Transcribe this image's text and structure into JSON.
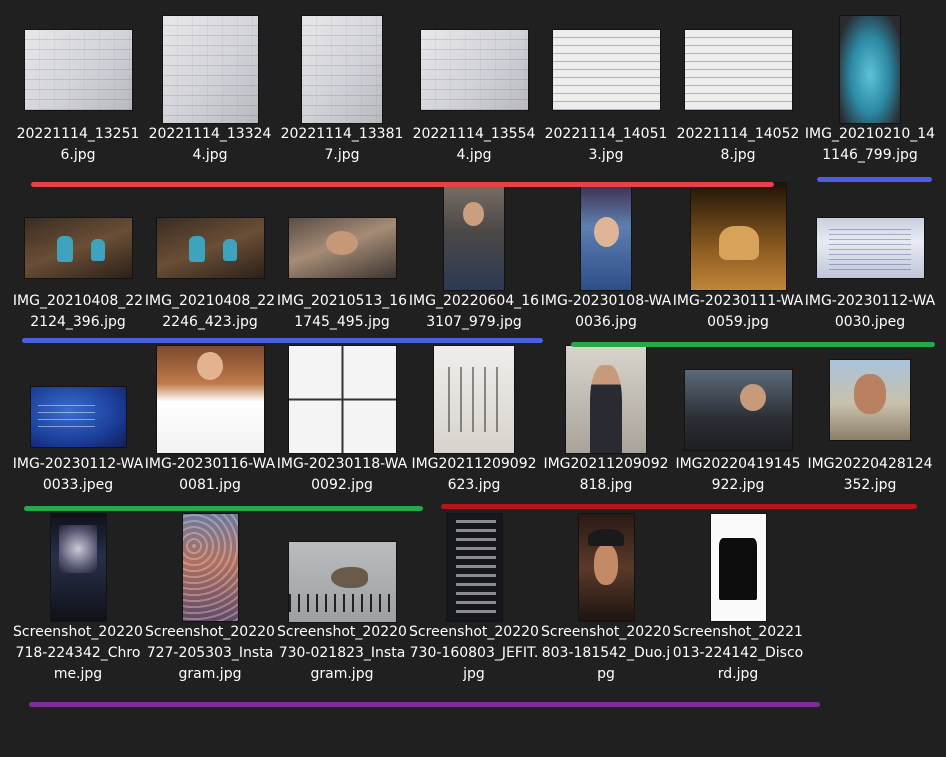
{
  "files": [
    {
      "name": "20221114_132516.jpg",
      "icon": "image-thumbnail-whiteboard"
    },
    {
      "name": "20221114_133244.jpg",
      "icon": "image-thumbnail-whiteboard"
    },
    {
      "name": "20221114_133817.jpg",
      "icon": "image-thumbnail-whiteboard"
    },
    {
      "name": "20221114_135544.jpg",
      "icon": "image-thumbnail-whiteboard"
    },
    {
      "name": "20221114_140513.jpg",
      "icon": "image-thumbnail-notes"
    },
    {
      "name": "20221114_140528.jpg",
      "icon": "image-thumbnail-notes"
    },
    {
      "name": "IMG_20210210_141146_799.jpg",
      "icon": "image-thumbnail-figurine"
    },
    {
      "name": "IMG_20210408_222124_396.jpg",
      "icon": "image-thumbnail-figurines"
    },
    {
      "name": "IMG_20210408_222246_423.jpg",
      "icon": "image-thumbnail-figurines"
    },
    {
      "name": "IMG_20210513_161745_495.jpg",
      "icon": "image-thumbnail-selfie"
    },
    {
      "name": "IMG_20220604_163107_979.jpg",
      "icon": "image-thumbnail-mirror-selfie"
    },
    {
      "name": "IMG-20230108-WA0036.jpg",
      "icon": "image-thumbnail-graduation"
    },
    {
      "name": "IMG-20230111-WA0059.jpg",
      "icon": "image-thumbnail-cat"
    },
    {
      "name": "IMG-20230112-WA0030.jpeg",
      "icon": "image-thumbnail-screen"
    },
    {
      "name": "IMG-20230112-WA0033.jpeg",
      "icon": "image-thumbnail-screen-blue"
    },
    {
      "name": "IMG-20230116-WA0081.jpg",
      "icon": "image-thumbnail-video-post"
    },
    {
      "name": "IMG-20230118-WA0092.jpg",
      "icon": "image-thumbnail-comic"
    },
    {
      "name": "IMG20211209092623.jpg",
      "icon": "image-thumbnail-sketch"
    },
    {
      "name": "IMG20211209092818.jpg",
      "icon": "image-thumbnail-portrait"
    },
    {
      "name": "IMG20220419145922.jpg",
      "icon": "image-thumbnail-car"
    },
    {
      "name": "IMG20220428124352.jpg",
      "icon": "image-thumbnail-portrait"
    },
    {
      "name": "Screenshot_20220718-224342_Chrome.jpg",
      "icon": "image-thumbnail-phone-screenshot"
    },
    {
      "name": "Screenshot_20220727-205303_Instagram.jpg",
      "icon": "image-thumbnail-phone-screenshot"
    },
    {
      "name": "Screenshot_20220730-021823_Instagram.jpg",
      "icon": "image-thumbnail-squirrel"
    },
    {
      "name": "Screenshot_20220730-160803_JEFIT.jpg",
      "icon": "image-thumbnail-phone-screenshot"
    },
    {
      "name": "Screenshot_20220803-181542_Duo.jpg",
      "icon": "image-thumbnail-phone-screenshot"
    },
    {
      "name": "Screenshot_20221013-224142_Discord.jpg",
      "icon": "image-thumbnail-phone-screenshot"
    }
  ],
  "group_colors": {
    "red": "#e8414a",
    "blue": "#4d5fe0",
    "green": "#27a84a",
    "darkred": "#b8141c",
    "purple": "#7a2e9a"
  },
  "background": "#202020"
}
